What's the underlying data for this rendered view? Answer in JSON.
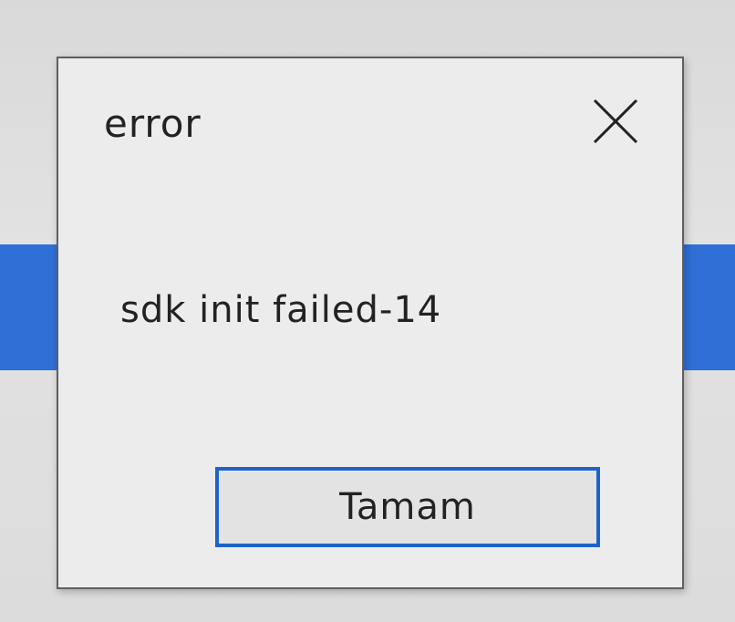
{
  "dialog": {
    "title": "error",
    "message": "sdk init failed-14",
    "ok_button_label": "Tamam",
    "close_icon": "close-icon"
  },
  "colors": {
    "dialog_background": "#ececec",
    "background_band": "#2f6fd6",
    "button_focus_border": "#1e63c9",
    "text": "#222222"
  }
}
